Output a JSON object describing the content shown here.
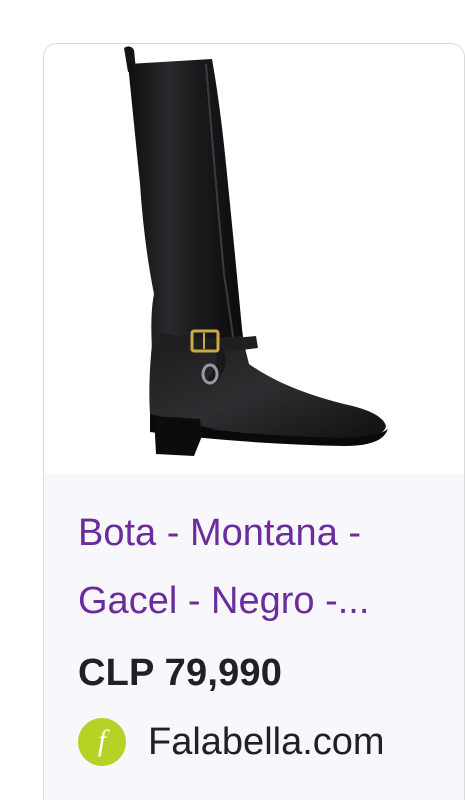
{
  "product": {
    "image_alt": "Black leather knee-high riding boot with gold buckle strap",
    "title": "Bota - Montana - Gacel - Negro -...",
    "price": "CLP 79,990",
    "source": {
      "icon": "falabella-logo-icon",
      "icon_letter": "f",
      "name": "Falabella.com"
    }
  },
  "colors": {
    "title": "#6b2c9e",
    "price": "#202124",
    "favicon": "#b5d324",
    "card_bg": "#f8f7fb"
  }
}
